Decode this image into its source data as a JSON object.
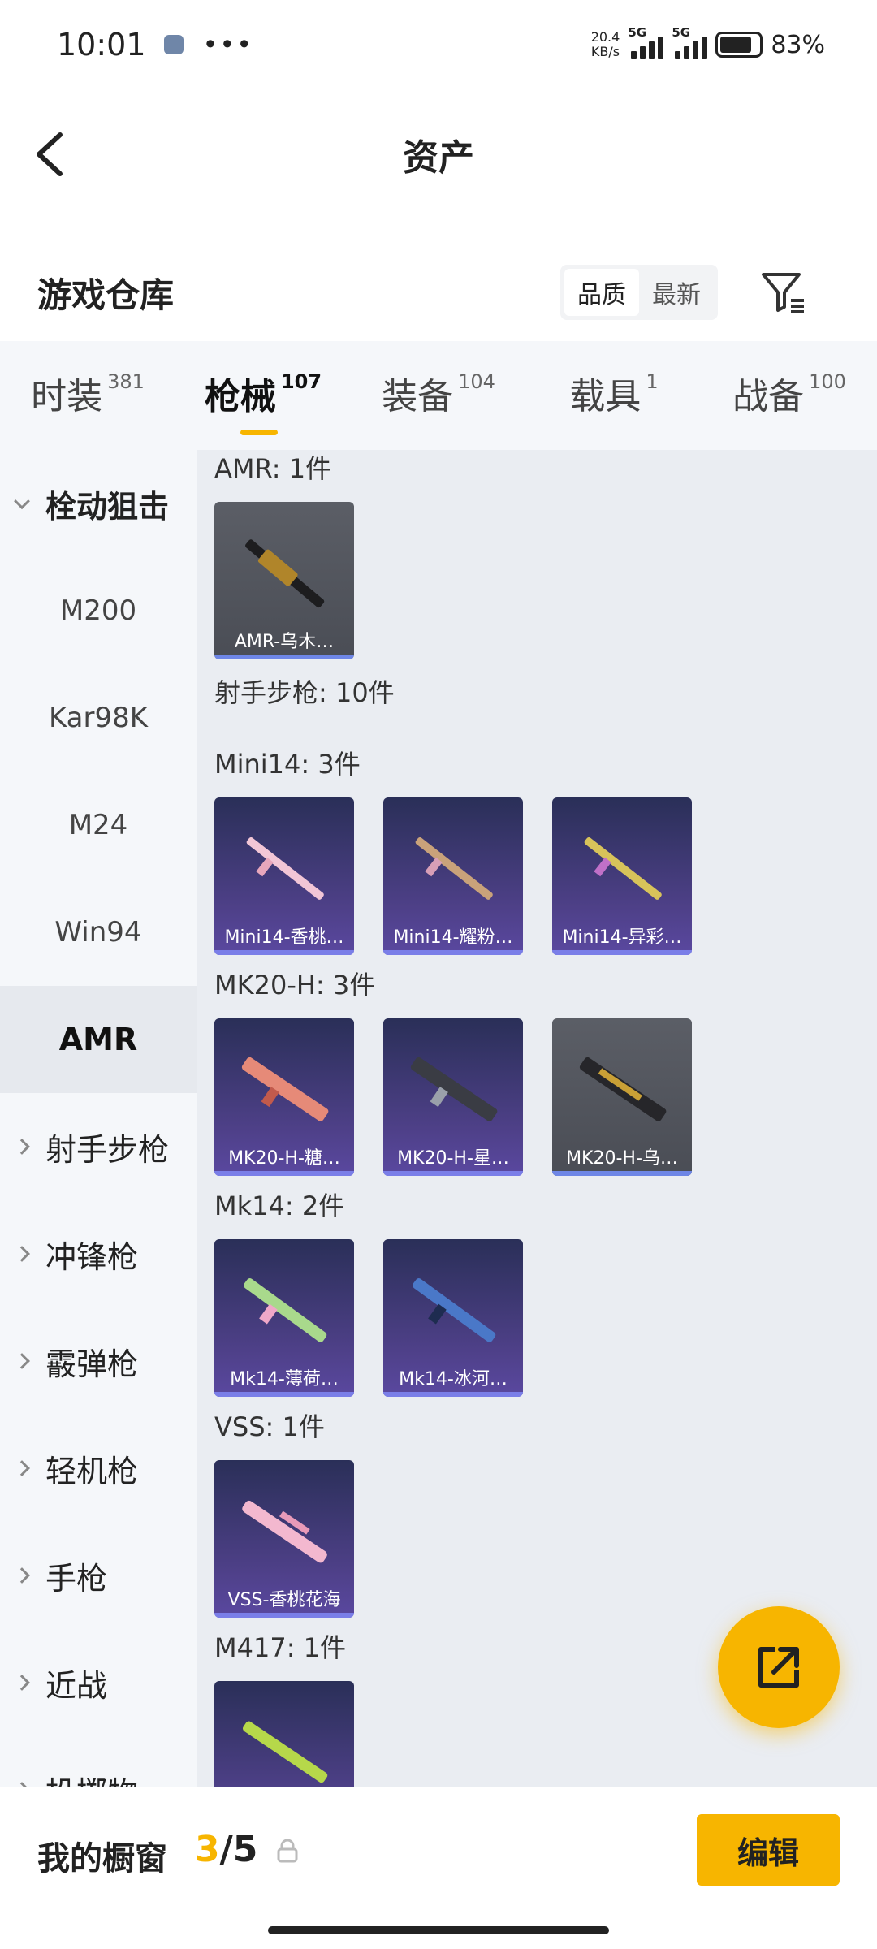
{
  "status": {
    "time": "10:01",
    "net_speed_top": "20.4",
    "net_speed_bottom": "KB/s",
    "sig1": "5G",
    "sig2": "5G",
    "battery": "83%"
  },
  "nav": {
    "title": "资产"
  },
  "header": {
    "title": "游戏仓库",
    "sort_options": [
      "品质",
      "最新"
    ]
  },
  "tabs": [
    {
      "name": "时装",
      "count": "381"
    },
    {
      "name": "枪械",
      "count": "107"
    },
    {
      "name": "装备",
      "count": "104"
    },
    {
      "name": "载具",
      "count": "1"
    },
    {
      "name": "战备",
      "count": "100"
    }
  ],
  "sidebar": {
    "groups": [
      "栓动狙击",
      "射手步枪",
      "冲锋枪",
      "霰弹枪",
      "轻机枪",
      "手枪",
      "近战",
      "投掷物"
    ],
    "subitems": [
      "M200",
      "Kar98K",
      "M24",
      "Win94",
      "AMR"
    ]
  },
  "content": {
    "amr_label": "AMR: 1件",
    "amr_items": [
      "AMR-乌木…"
    ],
    "marksman_label": "射手步枪: 10件",
    "mini14_label": "Mini14: 3件",
    "mini14_items": [
      "Mini14-香桃…",
      "Mini14-耀粉…",
      "Mini14-异彩…"
    ],
    "mk20_label": "MK20-H: 3件",
    "mk20_items": [
      "MK20-H-糖…",
      "MK20-H-星…",
      "MK20-H-乌…"
    ],
    "mk14_label": "Mk14: 2件",
    "mk14_items": [
      "Mk14-薄荷…",
      "Mk14-冰河…"
    ],
    "vss_label": "VSS: 1件",
    "vss_items": [
      "VSS-香桃花海"
    ],
    "m417_label": "M417: 1件"
  },
  "bottom": {
    "label": "我的橱窗",
    "current": "3",
    "total": "/5",
    "edit": "编辑"
  },
  "colors": {
    "accent": "#f7b500",
    "card_purple": "#4e4088",
    "card_grey": "#55585f"
  }
}
